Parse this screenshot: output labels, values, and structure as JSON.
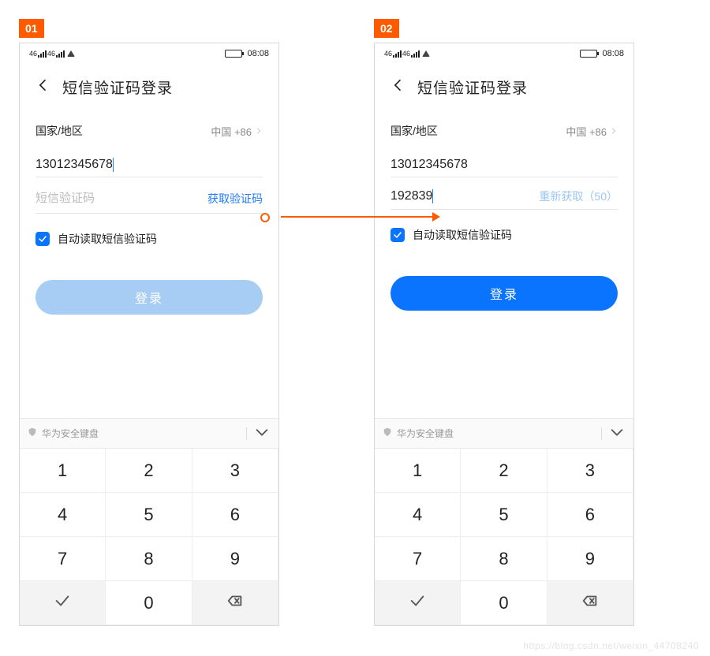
{
  "badges": {
    "b1": "01",
    "b2": "02"
  },
  "status": {
    "time": "08:08"
  },
  "header": {
    "title": "短信验证码登录"
  },
  "region": {
    "label": "国家/地区",
    "value": "中国 +86"
  },
  "phone_field": {
    "value": "13012345678"
  },
  "code_field": {
    "placeholder": "短信验证码",
    "entered_value": "192839",
    "action_get": "获取验证码",
    "action_resend": "重新获取（50）"
  },
  "checkbox_label": "自动读取短信验证码",
  "login_label": "登录",
  "keyboard": {
    "header": "华为安全键盘",
    "keys": [
      "1",
      "2",
      "3",
      "4",
      "5",
      "6",
      "7",
      "8",
      "9",
      "",
      "0",
      ""
    ]
  },
  "watermark": "https://blog.csdn.net/weixin_44708240"
}
